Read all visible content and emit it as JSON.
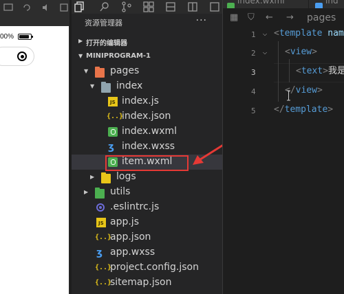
{
  "simulator": {
    "battery_text": "00%"
  },
  "explorer": {
    "title": "资源管理器",
    "more_label": "···",
    "open_editors_label": "打开的编辑器",
    "project_label": "MINIPROGRAM-1",
    "tree": [
      {
        "name": "pages",
        "type": "folder",
        "icon": "folder-icon",
        "color": "#e8744a",
        "expanded": true
      },
      {
        "name": "index",
        "type": "folder",
        "icon": "folder-open-icon",
        "color": "#90a4ae",
        "expanded": true
      },
      {
        "name": "index.js",
        "type": "js",
        "icon": "js-file-icon"
      },
      {
        "name": "index.json",
        "type": "json",
        "icon": "json-file-icon"
      },
      {
        "name": "index.wxml",
        "type": "wxml",
        "icon": "wxml-file-icon"
      },
      {
        "name": "index.wxss",
        "type": "wxss",
        "icon": "wxss-file-icon"
      },
      {
        "name": "item.wxml",
        "type": "wxml",
        "icon": "wxml-file-icon",
        "selected": true
      },
      {
        "name": "logs",
        "type": "folder",
        "icon": "folder-icon",
        "color": "#e8c619",
        "expanded": false
      },
      {
        "name": "utils",
        "type": "folder",
        "icon": "folder-icon",
        "color": "#4caf50",
        "expanded": false
      },
      {
        "name": ".eslintrc.js",
        "type": "eslint",
        "icon": "eslint-file-icon"
      },
      {
        "name": "app.js",
        "type": "js",
        "icon": "js-file-icon"
      },
      {
        "name": "app.json",
        "type": "json",
        "icon": "json-file-icon"
      },
      {
        "name": "app.wxss",
        "type": "wxss",
        "icon": "wxss-file-icon"
      },
      {
        "name": "project.config.json",
        "type": "json",
        "icon": "json-file-icon"
      },
      {
        "name": "sitemap.json",
        "type": "json",
        "icon": "json-file-icon"
      }
    ]
  },
  "editor": {
    "tabs": [
      {
        "label": "index.wxml",
        "icon": "wxml-file-icon"
      },
      {
        "label": "ind",
        "icon": "wxml-file-icon"
      }
    ],
    "breadcrumb": "pages",
    "lines": [
      {
        "num": "1",
        "foldable": true
      },
      {
        "num": "2",
        "foldable": true
      },
      {
        "num": "3",
        "foldable": false,
        "active": true
      },
      {
        "num": "4",
        "foldable": false
      },
      {
        "num": "5",
        "foldable": false
      }
    ],
    "code": {
      "line1_open": "<",
      "line1_tag": "template",
      "line1_attr": " nam",
      "line2_open": "<",
      "line2_tag": "view",
      "line2_close": ">",
      "line3_open": "<",
      "line3_tag": "text",
      "line3_close": ">",
      "line3_text": "我是",
      "line4_open": "</",
      "line4_tag": "view",
      "line4_close": ">",
      "line5_open": "</",
      "line5_tag": "template",
      "line5_close": ">"
    }
  },
  "colors": {
    "highlight_box": "#e53935",
    "arrow": "#e53935",
    "selected_row": "#37373d"
  }
}
